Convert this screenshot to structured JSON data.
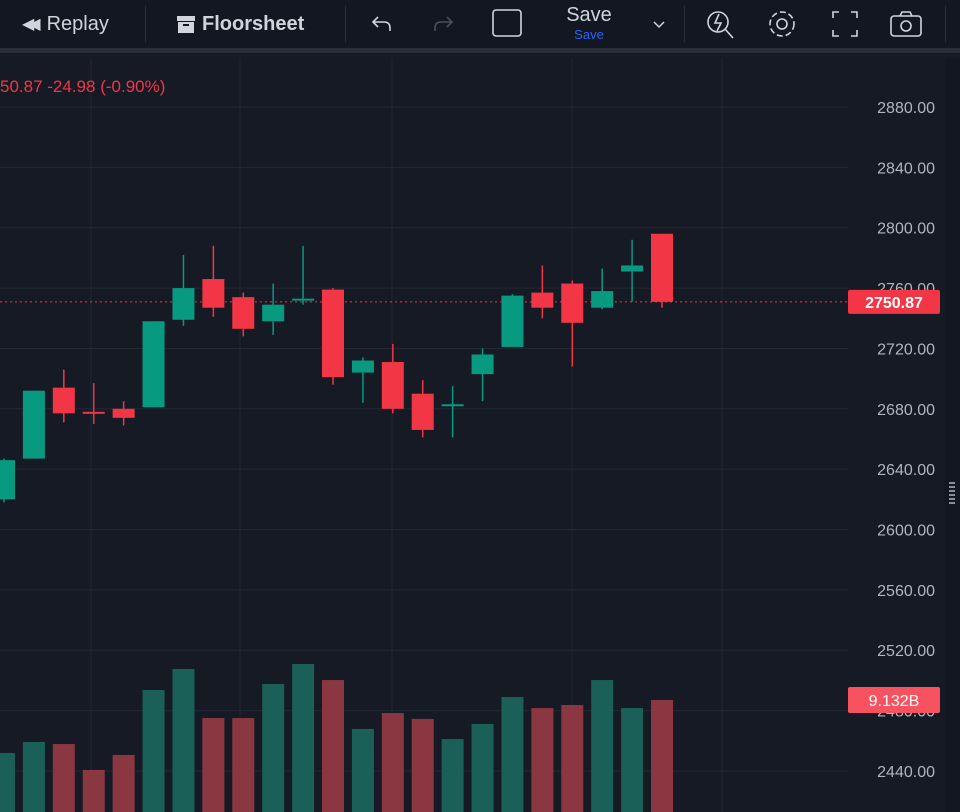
{
  "toolbar": {
    "replay": "Replay",
    "floorsheet": "Floorsheet",
    "save": "Save",
    "save_sub": "Save",
    "icons": [
      "replay-icon",
      "floorsheet-icon",
      "undo-icon",
      "redo-icon",
      "layout-square-icon",
      "chevron-down-icon",
      "quick-search-icon",
      "gear-icon",
      "fullscreen-icon",
      "camera-icon"
    ]
  },
  "legend": {
    "text": "50.87  -24.98 (-0.90%)"
  },
  "colors": {
    "up": "#089981",
    "down": "#f23645",
    "vol_up": "#1b5f59",
    "vol_down": "#8a3742",
    "bg": "#161a25"
  },
  "chart_data": {
    "type": "candlestick",
    "price_ticks": [
      "2880.00",
      "2840.00",
      "2800.00",
      "2760.00",
      "2720.00",
      "2680.00",
      "2640.00",
      "2600.00",
      "2560.00",
      "2520.00",
      "2480.00",
      "2440.00"
    ],
    "last_price": "2750.87",
    "last_volume": "9.132B",
    "candles": [
      {
        "o": 2620,
        "h": 2647,
        "l": 2618,
        "c": 2646,
        "v": 5.1
      },
      {
        "o": 2647,
        "h": 2692,
        "l": 2647,
        "c": 2692,
        "v": 5.94
      },
      {
        "o": 2694,
        "h": 2706,
        "l": 2671,
        "c": 2677,
        "v": 5.78
      },
      {
        "o": 2678,
        "h": 2697,
        "l": 2670,
        "c": 2677,
        "v": 3.81
      },
      {
        "o": 2680,
        "h": 2685,
        "l": 2669,
        "c": 2674,
        "v": 4.95
      },
      {
        "o": 2681,
        "h": 2738,
        "l": 2681,
        "c": 2738,
        "v": 9.89
      },
      {
        "o": 2739,
        "h": 2782,
        "l": 2735,
        "c": 2760,
        "v": 11.49
      },
      {
        "o": 2766,
        "h": 2788,
        "l": 2741,
        "c": 2747,
        "v": 7.76
      },
      {
        "o": 2754,
        "h": 2757,
        "l": 2728,
        "c": 2733,
        "v": 7.76
      },
      {
        "o": 2738,
        "h": 2763,
        "l": 2729,
        "c": 2749,
        "v": 10.35
      },
      {
        "o": 2752,
        "h": 2788,
        "l": 2749,
        "c": 2753,
        "v": 11.87
      },
      {
        "o": 2759,
        "h": 2760,
        "l": 2696,
        "c": 2701,
        "v": 10.65
      },
      {
        "o": 2704,
        "h": 2714,
        "l": 2684,
        "c": 2712,
        "v": 6.93
      },
      {
        "o": 2711,
        "h": 2723,
        "l": 2677,
        "c": 2680,
        "v": 8.14
      },
      {
        "o": 2690,
        "h": 2699,
        "l": 2661,
        "c": 2666,
        "v": 7.69
      },
      {
        "o": 2682,
        "h": 2695,
        "l": 2661,
        "c": 2683,
        "v": 6.16
      },
      {
        "o": 2703,
        "h": 2720,
        "l": 2685,
        "c": 2716,
        "v": 7.31
      },
      {
        "o": 2721,
        "h": 2756,
        "l": 2721,
        "c": 2755,
        "v": 9.36
      },
      {
        "o": 2757,
        "h": 2775,
        "l": 2740,
        "c": 2747,
        "v": 8.52
      },
      {
        "o": 2763,
        "h": 2765,
        "l": 2708,
        "c": 2737,
        "v": 8.75
      },
      {
        "o": 2747,
        "h": 2773,
        "l": 2746,
        "c": 2758,
        "v": 10.65
      },
      {
        "o": 2771,
        "h": 2792,
        "l": 2751,
        "c": 2775,
        "v": 8.52
      },
      {
        "o": 2796,
        "h": 2796,
        "l": 2747,
        "c": 2750.87,
        "v": 9.132
      }
    ]
  }
}
